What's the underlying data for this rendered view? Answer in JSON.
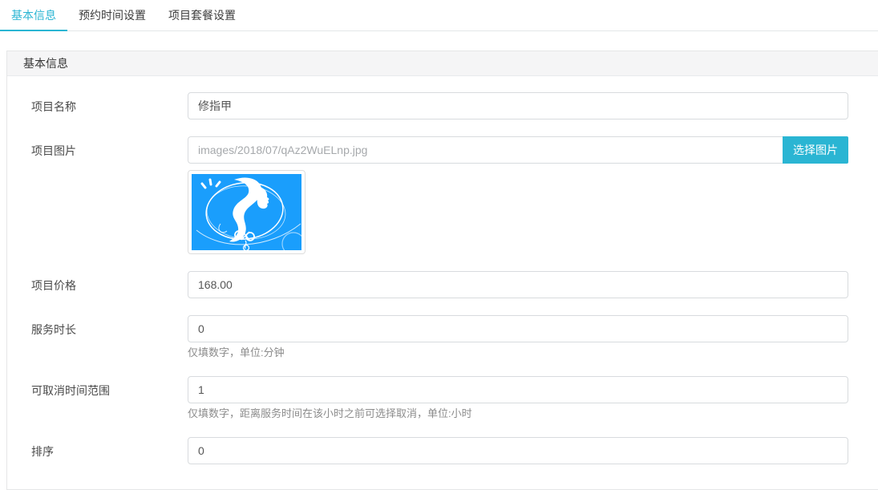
{
  "colors": {
    "accent": "#2ab5d3",
    "thumbnail_blue": "#1a9efc"
  },
  "tabs": [
    {
      "label": "基本信息",
      "active": true
    },
    {
      "label": "预约时间设置",
      "active": false
    },
    {
      "label": "项目套餐设置",
      "active": false
    }
  ],
  "panel": {
    "title": "基本信息"
  },
  "form": {
    "name": {
      "label": "项目名称",
      "value": "修指甲"
    },
    "image": {
      "label": "项目图片",
      "value": "images/2018/07/qAz2WuELnp.jpg",
      "button_label": "选择图片",
      "thumbnail_icon": "beauty-salon-logo"
    },
    "price": {
      "label": "项目价格",
      "value": "168.00"
    },
    "duration": {
      "label": "服务时长",
      "value": "0",
      "hint": "仅填数字，单位:分钟"
    },
    "cancel_range": {
      "label": "可取消时间范围",
      "value": "1",
      "hint": "仅填数字，距离服务时间在该小时之前可选择取消，单位:小时"
    },
    "sort": {
      "label": "排序",
      "value": "0"
    }
  }
}
